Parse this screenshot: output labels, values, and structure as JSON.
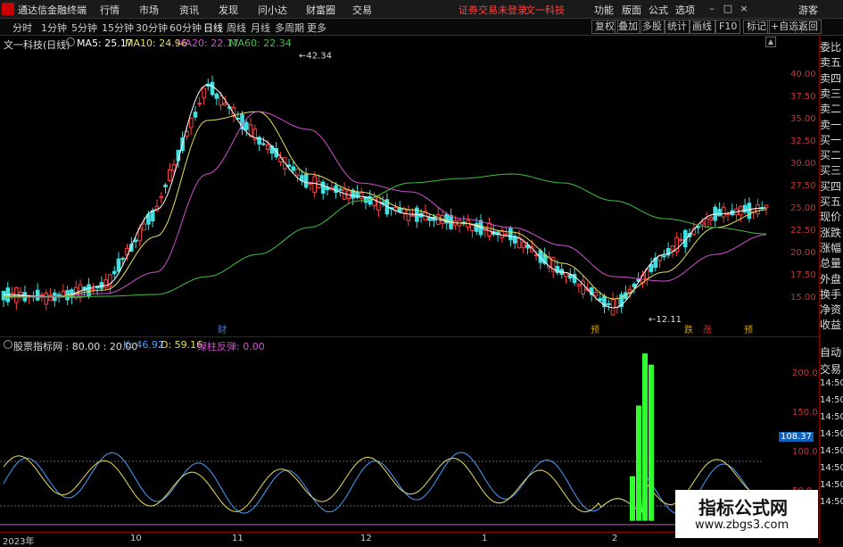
{
  "app": {
    "name": "通达信金融终端",
    "menu": [
      "行情",
      "市场",
      "资讯",
      "发现",
      "问小达",
      "财富圈",
      "交易"
    ],
    "notice": "证券交易未登录",
    "stock_title": "文一科技",
    "right_menu": [
      "功能",
      "版面",
      "公式",
      "选项"
    ],
    "guest": "游客",
    "window_buttons": [
      "–",
      "□",
      "×"
    ]
  },
  "toolbar": {
    "periods": [
      "分时",
      "1分钟",
      "5分钟",
      "15分钟",
      "30分钟",
      "60分钟",
      "日线",
      "周线",
      "月线",
      "多周期",
      "更多"
    ],
    "active_period": "日线",
    "right": [
      "复权",
      "叠加",
      "多股",
      "统计",
      "画线",
      "F10",
      "标记",
      "+自选",
      "返回"
    ]
  },
  "main_chart": {
    "title": "文一科技(日线)",
    "ma5": "MA5: 25.17",
    "ma10": "MA10: 24.96",
    "ma20": "MA20: 22.17",
    "ma60": "MA60: 22.34",
    "high_label": "42.34",
    "low_label": "12.11",
    "yticks": [
      "40.00",
      "37.50",
      "35.00",
      "32.50",
      "30.00",
      "27.50",
      "25.00",
      "22.50",
      "20.00",
      "17.50",
      "15.00"
    ],
    "markers": [
      {
        "text": "财",
        "color": "#4a7fd0"
      },
      {
        "text": "预",
        "color": "#d0a000"
      },
      {
        "text": "跌",
        "color": "#d0a000"
      },
      {
        "text": "涨",
        "color": "#d03030"
      },
      {
        "text": "预",
        "color": "#d0a000"
      }
    ],
    "colors": {
      "ma5": "#ffffff",
      "ma10": "#e8e060",
      "ma20": "#d050d0",
      "ma60": "#40c040",
      "up": "#ff4040",
      "down": "#40e0e0"
    }
  },
  "indicator": {
    "title": "股票指标网 : 80.00 : 20.00",
    "k": "K: 46.92",
    "d": "D: 59.16",
    "extra": "绿柱反弹: 0.00",
    "yticks": [
      "200.0",
      "150.0",
      "100.0",
      "50.0"
    ],
    "current": "108.37"
  },
  "xaxis": [
    "2023年",
    "10",
    "11",
    "12",
    "1",
    "2"
  ],
  "sidebar": [
    "委比",
    "卖五",
    "卖四",
    "卖三",
    "卖二",
    "卖一",
    "买一",
    "买二",
    "买三",
    "买四",
    "买五",
    "现价",
    "涨跌",
    "涨幅",
    "总量",
    "外盘",
    "换手",
    "净资",
    "收益",
    "自动",
    "交易",
    "14:50",
    "14:50",
    "14:50",
    "14:50",
    "14:50",
    "14:50",
    "14:50",
    "14:50"
  ],
  "watermark": {
    "title": "指标公式网",
    "url": "www.zbgs3.com"
  },
  "chart_data": {
    "type": "line",
    "title": "文一科技(日线)",
    "x": [
      "2023-09",
      "2023-10",
      "2023-11",
      "2023-12",
      "2024-01",
      "2024-02"
    ],
    "series": [
      {
        "name": "MA5",
        "values": [
          15.5,
          15.2,
          16.5,
          25,
          39,
          33,
          28,
          26.5,
          24.5,
          23.5,
          22,
          18,
          14,
          20,
          24.5,
          25.2
        ]
      },
      {
        "name": "MA10",
        "values": [
          15.3,
          15.3,
          16,
          22,
          35,
          36,
          29,
          27,
          25,
          23.5,
          22.5,
          19,
          15,
          18,
          23,
          25
        ]
      },
      {
        "name": "MA20",
        "values": [
          15.2,
          15.3,
          15.6,
          18,
          29,
          36,
          34,
          28,
          27,
          24,
          23,
          21,
          17.5,
          17,
          20,
          22.2
        ]
      },
      {
        "name": "MA60",
        "values": [
          15.2,
          15.2,
          15.3,
          15.5,
          17.5,
          20,
          23,
          26,
          28,
          28.5,
          29,
          28,
          26,
          24,
          23,
          22.3
        ]
      }
    ],
    "ylim": [
      12,
      42
    ],
    "annotations": [
      "42.34",
      "12.11"
    ]
  }
}
